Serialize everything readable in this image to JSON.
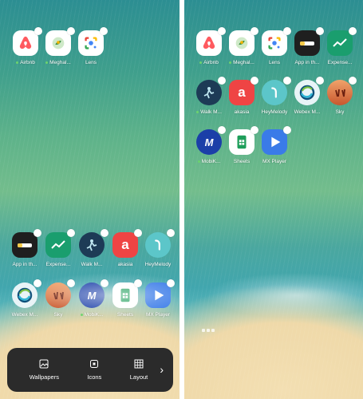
{
  "left_screen": {
    "top_row": [
      {
        "label": "Airbnb",
        "icon": "airbnb-icon",
        "dot": true
      },
      {
        "label": "Meghal...",
        "icon": "meghalaya-icon",
        "dot": true
      },
      {
        "label": "Lens",
        "icon": "google-lens-icon",
        "dot": false
      }
    ],
    "row_a": [
      {
        "label": "App in th...",
        "icon": "app-in-the-air-icon",
        "dot": false
      },
      {
        "label": "Expense...",
        "icon": "expense-icon",
        "dot": false
      },
      {
        "label": "Walk M...",
        "icon": "walk-mate-icon",
        "dot": false
      },
      {
        "label": "akasia",
        "icon": "akasia-icon",
        "dot": false
      },
      {
        "label": "HeyMelody",
        "icon": "heymelody-icon",
        "dot": false
      }
    ],
    "row_b": [
      {
        "label": "Webex M...",
        "icon": "webex-icon",
        "dot": false
      },
      {
        "label": "Sky",
        "icon": "sky-icon",
        "dot": false
      },
      {
        "label": "MobiK...",
        "icon": "mobikwik-icon",
        "dot": true
      },
      {
        "label": "Sheets",
        "icon": "sheets-icon",
        "dot": false
      },
      {
        "label": "MX Player",
        "icon": "mx-player-icon",
        "dot": false
      }
    ],
    "bottom_bar": {
      "wallpapers": "Wallpapers",
      "icons": "Icons",
      "layout": "Layout",
      "more": "›"
    }
  },
  "right_screen": {
    "row1": [
      {
        "label": "Airbnb",
        "icon": "airbnb-icon",
        "dot": true
      },
      {
        "label": "Meghal...",
        "icon": "meghalaya-icon",
        "dot": true
      },
      {
        "label": "Lens",
        "icon": "google-lens-icon",
        "dot": false
      },
      {
        "label": "App in th...",
        "icon": "app-in-the-air-icon",
        "dot": false
      },
      {
        "label": "Expense...",
        "icon": "expense-icon",
        "dot": false
      }
    ],
    "row2": [
      {
        "label": "Walk M...",
        "icon": "walk-mate-icon",
        "dot": true
      },
      {
        "label": "akasia",
        "icon": "akasia-icon",
        "dot": false
      },
      {
        "label": "HeyMelody",
        "icon": "heymelody-icon",
        "dot": false
      },
      {
        "label": "Webex M...",
        "icon": "webex-icon",
        "dot": false
      },
      {
        "label": "Sky",
        "icon": "sky-icon",
        "dot": false
      }
    ],
    "row3": [
      {
        "label": "MobiK...",
        "icon": "mobikwik-icon",
        "dot": true
      },
      {
        "label": "Sheets",
        "icon": "sheets-icon",
        "dot": false
      },
      {
        "label": "MX Player",
        "icon": "mx-player-icon",
        "dot": false
      }
    ]
  },
  "colors": {
    "airbnb": "#ff5a5f",
    "akasia": "#ef4444",
    "heymelody": "#5cc6c9",
    "mobikwik": "#1b3fa8",
    "mx_player": "#3a7be8",
    "sheets": "#1e9e5a",
    "bottom_bar": "#2b2b2b"
  }
}
